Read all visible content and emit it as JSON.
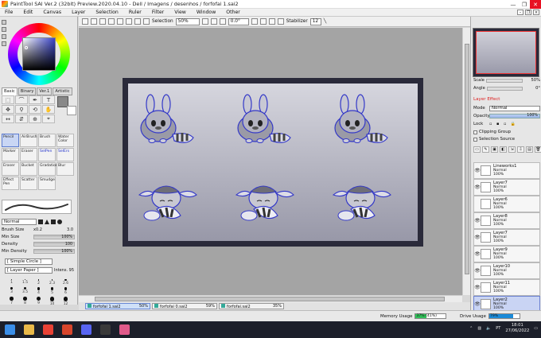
{
  "window": {
    "title": "PaintTool SAI Ver.2 (32bit) Preview.2020.04.10 - Dell / Imagens / desenhos / forfofai 1.sai2",
    "controls": [
      "—",
      "❐",
      "✕"
    ]
  },
  "menu": [
    "File",
    "Edit",
    "Canvas",
    "Layer",
    "Selection",
    "Ruler",
    "Filter",
    "View",
    "Window",
    "Other"
  ],
  "toolbar": {
    "selection_label": "Selection",
    "zoom": "50%",
    "angle": "0.0°",
    "stabilizer_label": "Stabilizer",
    "stabilizer_value": "12"
  },
  "left": {
    "tabs": [
      "Basic",
      "Binary",
      "Ver.1",
      "Artistic"
    ],
    "tool_glyphs": [
      "⬚",
      "⌒",
      "✒",
      "T",
      "✥",
      "⚲",
      "⟲",
      "✋",
      "↔",
      "⇵",
      "⊕",
      "⌖"
    ],
    "brushes": [
      {
        "label": "Pencil",
        "selected": true,
        "blue": false
      },
      {
        "label": "AirBrush",
        "selected": false,
        "blue": false
      },
      {
        "label": "Brush",
        "selected": false,
        "blue": false
      },
      {
        "label": "Water Color",
        "selected": false,
        "blue": false
      },
      {
        "label": "Marker",
        "selected": false,
        "blue": false
      },
      {
        "label": "Eraser",
        "selected": false,
        "blue": false
      },
      {
        "label": "SelPen",
        "selected": false,
        "blue": true
      },
      {
        "label": "SelErs",
        "selected": false,
        "blue": true
      },
      {
        "label": "Eraser",
        "selected": false,
        "blue": false
      },
      {
        "label": "Bucket",
        "selected": false,
        "blue": false
      },
      {
        "label": "Gradation",
        "selected": false,
        "blue": false
      },
      {
        "label": "Blur",
        "selected": false,
        "blue": false
      },
      {
        "label": "Effect Pen",
        "selected": false,
        "blue": false
      },
      {
        "label": "Scatter",
        "selected": false,
        "blue": false
      },
      {
        "label": "Smudge",
        "selected": false,
        "blue": false
      }
    ],
    "blend_mode": "Normal",
    "brush_size_label": "Brush Size",
    "brush_size_mult": "x0.2",
    "brush_size_value": "3.0",
    "min_size_label": "Min Size",
    "min_size_value": "100%",
    "density_label": "Density",
    "density_value": "100",
    "min_density_label": "Min Density",
    "min_density_value": "100%",
    "shape_combo": "[ Simple Circle ]",
    "texture_combo": "[ Layer Paper ]",
    "intens_label": "Intens.",
    "intens_value": "95",
    "sizes": [
      "1",
      "1.5",
      "2",
      "2.3",
      "2.6",
      "3",
      "3.5",
      "4",
      "5",
      "6",
      "7",
      "8",
      "9",
      "10",
      "12",
      "14",
      "16",
      "20",
      "25",
      "30",
      "35",
      "40",
      "50",
      "60",
      "70"
    ]
  },
  "documents": [
    {
      "name": "forfofai 1.sai2",
      "zoom": "50%",
      "active": true
    },
    {
      "name": "forfofai 0.sai2",
      "zoom": "59%",
      "active": false
    },
    {
      "name": "forfofai.sai2",
      "zoom": "35%",
      "active": false
    }
  ],
  "right": {
    "scale_label": "Scale",
    "scale_value": "50%",
    "angle_label": "Angle",
    "angle_value": "0°",
    "layer_effect_label": "Layer Effect",
    "mode_label": "Mode",
    "mode_value": "Normal",
    "opacity_label": "Opacity",
    "opacity_value": "100%",
    "lock_label": "Lock",
    "clipping_label": "Clipping Group",
    "selection_source_label": "Selection Source",
    "layers": [
      {
        "name": "Lineworks1",
        "mode": "Normal",
        "opacity": "100%",
        "visible": true,
        "selected": false
      },
      {
        "name": "Layer7",
        "mode": "Normal",
        "opacity": "100%",
        "visible": true,
        "selected": false
      },
      {
        "name": "Layer6",
        "mode": "Normal",
        "opacity": "100%",
        "visible": false,
        "selected": false
      },
      {
        "name": "Layer8",
        "mode": "Normal",
        "opacity": "100%",
        "visible": true,
        "selected": false
      },
      {
        "name": "Layer7",
        "mode": "Normal",
        "opacity": "100%",
        "visible": true,
        "selected": false
      },
      {
        "name": "Layer9",
        "mode": "Normal",
        "opacity": "100%",
        "visible": true,
        "selected": false
      },
      {
        "name": "Layer10",
        "mode": "Normal",
        "opacity": "100%",
        "visible": true,
        "selected": false
      },
      {
        "name": "Layer11",
        "mode": "Normal",
        "opacity": "100%",
        "visible": true,
        "selected": false
      },
      {
        "name": "Layer2",
        "mode": "Normal",
        "opacity": "100%",
        "visible": true,
        "selected": true
      }
    ]
  },
  "status": {
    "memory_label": "Memory Usage",
    "memory_value": "37% (41%)",
    "memory_fraction": 0.37,
    "drive_label": "Drive Usage",
    "drive_value": "79%",
    "drive_fraction": 0.79
  },
  "taskbar": {
    "apps": [
      {
        "name": "start-icon",
        "color": "#3a8ee8"
      },
      {
        "name": "folder-icon",
        "color": "#e9b949"
      },
      {
        "name": "chrome-icon",
        "color": "#e94235"
      },
      {
        "name": "sai-icon",
        "color": "#d8462c"
      },
      {
        "name": "discord-icon",
        "color": "#5865f2"
      },
      {
        "name": "app-icon",
        "color": "#3a3a3a"
      },
      {
        "name": "paint-icon",
        "color": "#e05a8a"
      }
    ],
    "lang": "PT",
    "time": "18:01",
    "date": "27/06/2022"
  }
}
